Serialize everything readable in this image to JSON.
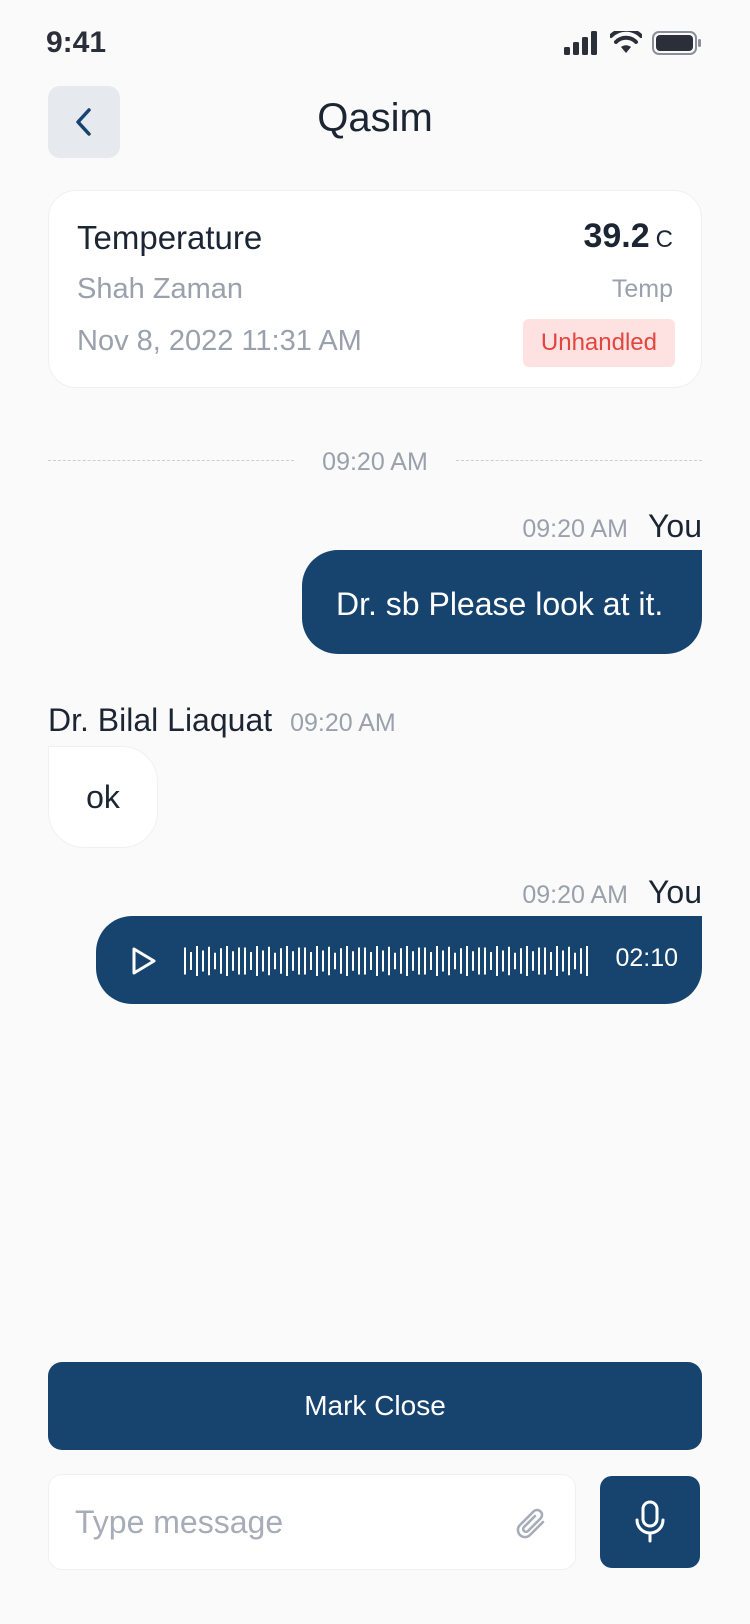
{
  "status_bar": {
    "time": "9:41",
    "icons": [
      "signal-icon",
      "wifi-icon",
      "battery-icon"
    ]
  },
  "header": {
    "back_icon": "chevron-left-icon",
    "title": "Qasim"
  },
  "alert_card": {
    "title": "Temperature",
    "value": "39.2",
    "unit": "C",
    "patient": "Shah Zaman",
    "type": "Temp",
    "datetime": "Nov 8, 2022 11:31 AM",
    "status": "Unhandled",
    "status_color": "#e3463f",
    "status_bg": "#fde2e1"
  },
  "chat": {
    "date_divider": "09:20 AM",
    "messages": [
      {
        "sender": "You",
        "time": "09:20 AM",
        "text": "Dr. sb Please look at it.",
        "direction": "out"
      },
      {
        "sender": "Dr. Bilal Liaquat",
        "time": "09:20 AM",
        "text": "ok",
        "direction": "in"
      },
      {
        "sender": "You",
        "time": "09:20 AM",
        "type": "voice",
        "duration": "02:10",
        "play_icon": "play-icon",
        "direction": "out"
      }
    ]
  },
  "actions": {
    "mark_close": "Mark Close"
  },
  "composer": {
    "placeholder": "Type message",
    "value": "",
    "attach_icon": "paperclip-icon",
    "mic_icon": "microphone-icon"
  },
  "colors": {
    "primary": "#17446f",
    "background": "#fafafa",
    "muted_text": "#9aa1ac"
  }
}
